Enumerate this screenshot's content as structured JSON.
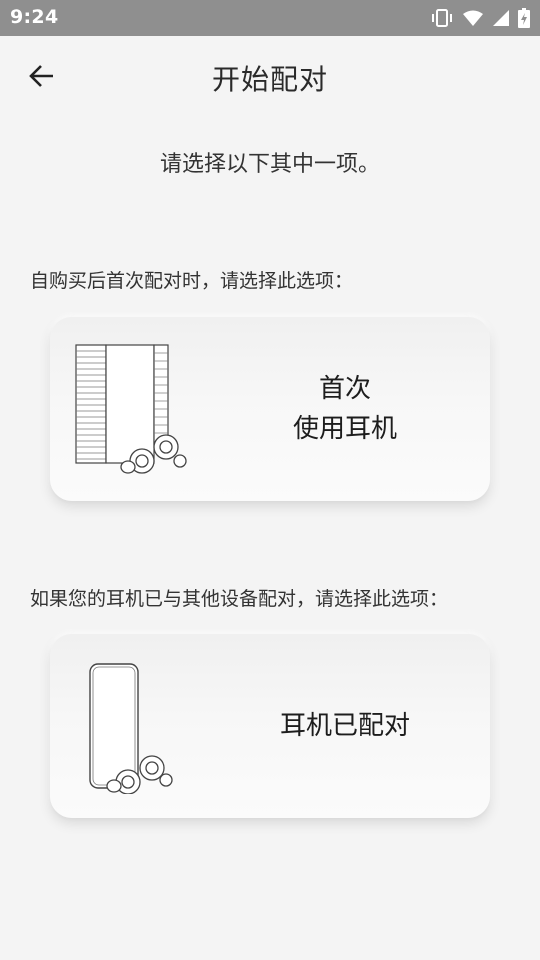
{
  "status_bar": {
    "time": "9:24",
    "icons": [
      "vibrate-icon",
      "wifi-icon",
      "cellular-signal-icon",
      "battery-charging-icon"
    ]
  },
  "header": {
    "back_icon": "arrow-left-icon",
    "title": "开始配对"
  },
  "main": {
    "prompt": "请选择以下其中一项。",
    "options": [
      {
        "label": "自购买后首次配对时，请选择此选项：",
        "card_line1": "首次",
        "card_line2": "使用耳机",
        "illustration": "earbuds-box-illustration"
      },
      {
        "label": "如果您的耳机已与其他设备配对，请选择此选项：",
        "card_text": "耳机已配对",
        "illustration": "phone-earbuds-illustration"
      }
    ]
  },
  "colors": {
    "status_bar": "#8f8f8f",
    "background": "#f4f4f4",
    "text": "#222222"
  }
}
